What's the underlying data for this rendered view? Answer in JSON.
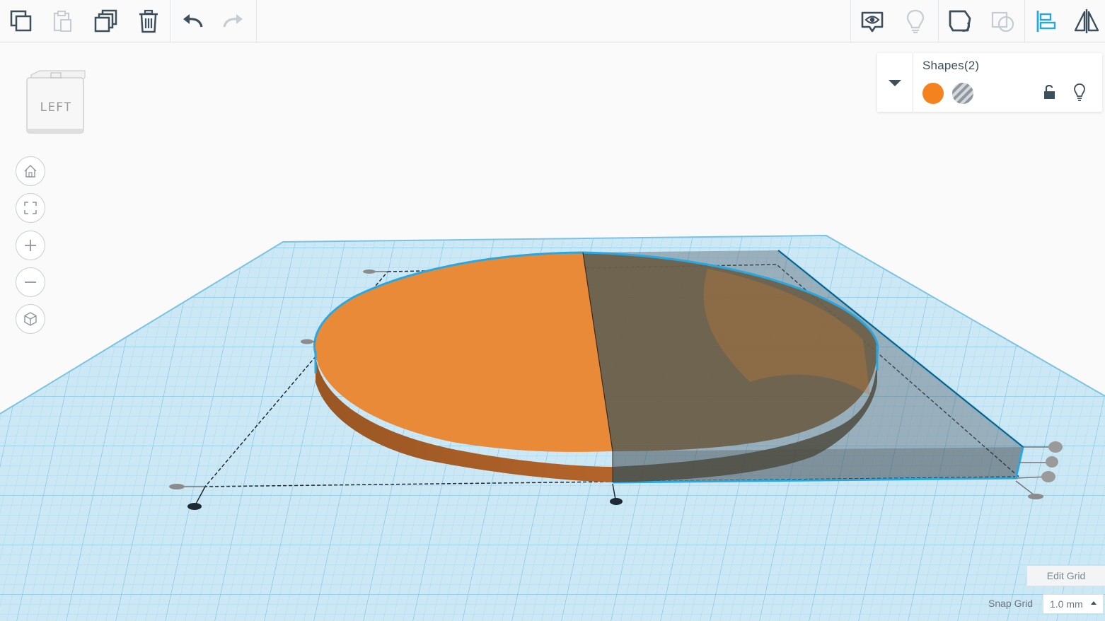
{
  "toolbar": {
    "left_tools": [
      "copy-icon",
      "paste-icon",
      "duplicate-icon",
      "delete-icon",
      "undo-icon",
      "redo-icon"
    ],
    "right_tools": [
      "show-all-icon",
      "hide-icon",
      "group-icon",
      "ungroup-icon",
      "align-icon",
      "mirror-icon"
    ]
  },
  "viewcube": {
    "face_label": "LEFT"
  },
  "nav": [
    "home-view-icon",
    "fit-view-icon",
    "zoom-in-icon",
    "zoom-out-icon",
    "perspective-icon"
  ],
  "shapes_panel": {
    "title": "Shapes(2)",
    "solid_color": "#f4821f",
    "hole_pattern": "hole-stripes"
  },
  "grid": {
    "edit_label": "Edit Grid",
    "snap_label": "Snap Grid",
    "snap_value": "1.0 mm"
  },
  "colors": {
    "accent_blue": "#29a8e0",
    "cylinder_orange": "#e98a38",
    "workplane_blue": "#c8e6f4"
  }
}
